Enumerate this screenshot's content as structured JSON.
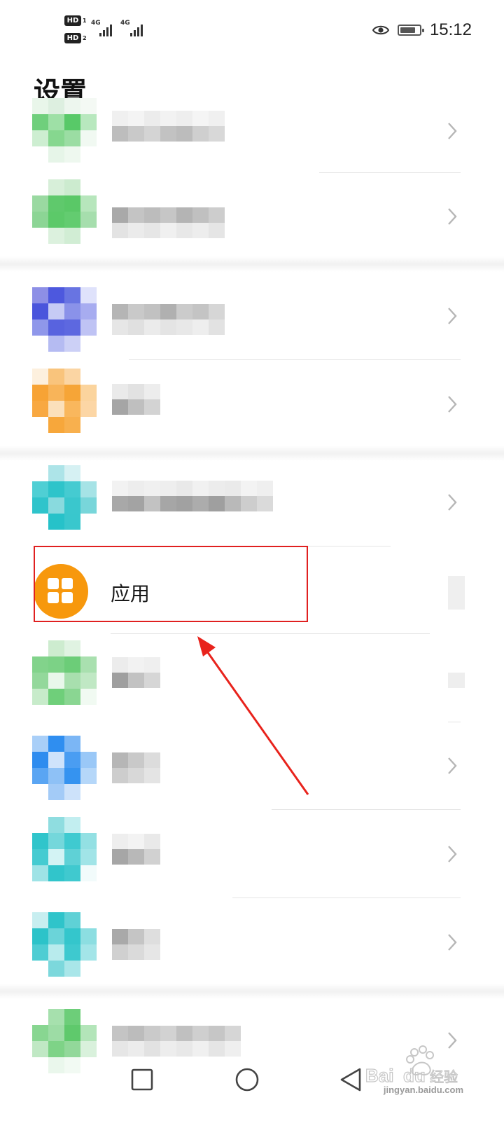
{
  "status_bar": {
    "sim1": "HD",
    "sim1_index": "1",
    "sim2": "HD",
    "sim2_index": "2",
    "network1": "4G",
    "network2": "4G",
    "time": "15:12",
    "battery_level": 0.8,
    "icons": [
      "eye-icon",
      "battery-icon",
      "signal-icon"
    ]
  },
  "page": {
    "title": "设置"
  },
  "settings_list": {
    "items": [
      {
        "label": "",
        "icon": "blurred-green-icon",
        "obscured": true
      },
      {
        "label": "",
        "icon": "blurred-green-icon",
        "obscured": true
      },
      {
        "label": "",
        "icon": "blurred-blue-icon",
        "obscured": true
      },
      {
        "label": "",
        "icon": "blurred-orange-icon",
        "obscured": true
      },
      {
        "label": "",
        "icon": "blurred-teal-icon",
        "obscured": true
      },
      {
        "label": "应用",
        "icon": "apps-grid-icon",
        "obscured": false,
        "highlighted": true
      },
      {
        "label": "",
        "icon": "blurred-green-icon",
        "obscured": true
      },
      {
        "label": "",
        "icon": "blurred-blue-icon",
        "obscured": true
      },
      {
        "label": "",
        "icon": "blurred-teal-icon",
        "obscured": true
      },
      {
        "label": "",
        "icon": "blurred-teal-icon",
        "obscured": true
      },
      {
        "label": "",
        "icon": "blurred-green-icon",
        "obscured": true
      }
    ]
  },
  "colors": {
    "apps_icon": "#f7980d",
    "highlight_box": "#e02020",
    "annotation_arrow": "#e8231c"
  },
  "nav_bar": {
    "buttons": [
      "recents-square-icon",
      "home-circle-icon",
      "back-triangle-icon"
    ]
  },
  "watermark": {
    "text": "jingyan.baidu.com"
  }
}
